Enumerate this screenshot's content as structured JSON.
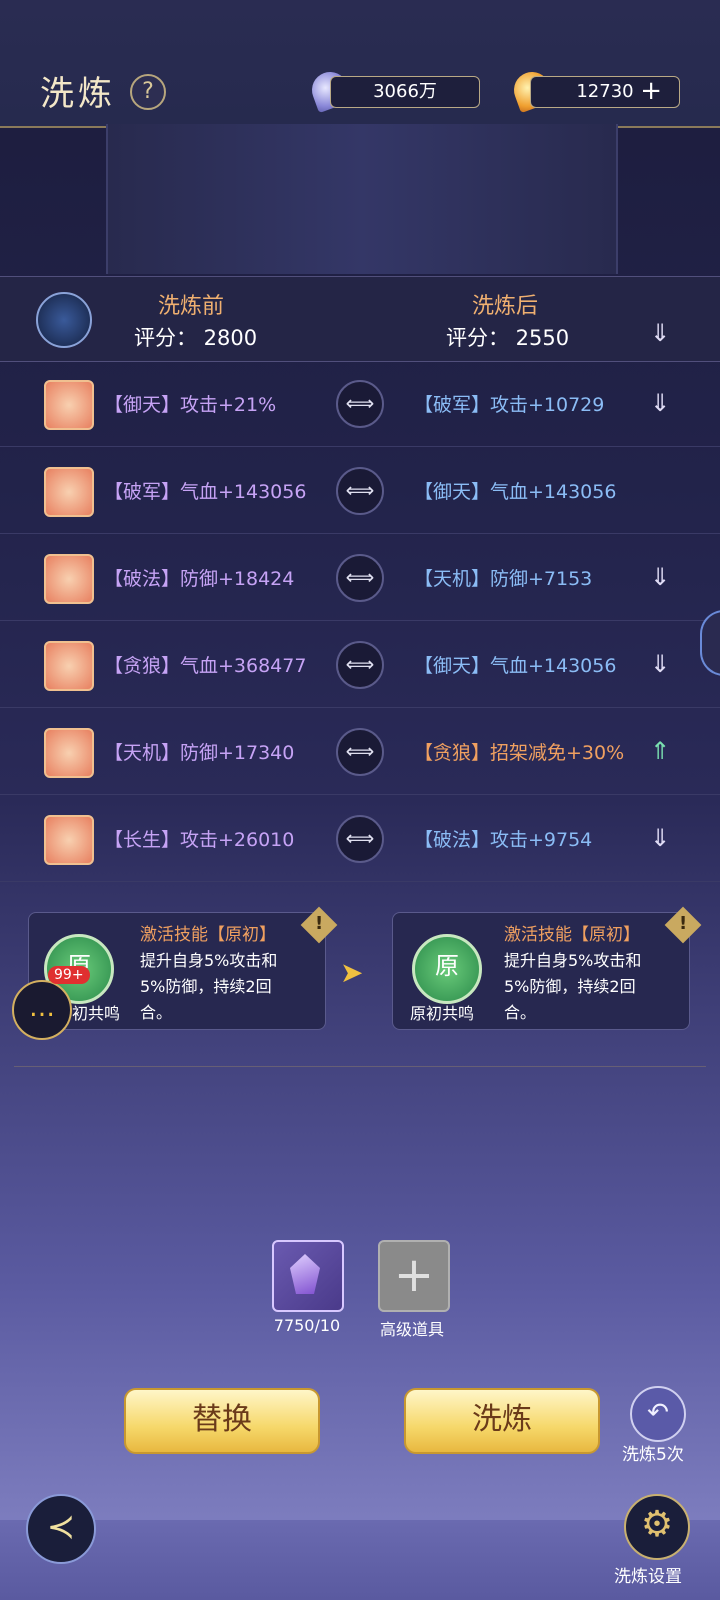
{
  "header": {
    "title": "洗炼",
    "help": "?",
    "currency1": "3066万",
    "currency2": "12730",
    "plus": "+"
  },
  "compare": {
    "before_label": "洗炼前",
    "after_label": "洗炼后",
    "before_score": "评分：  2800",
    "after_score": "评分：  2550"
  },
  "rows": [
    {
      "left": "【御天】攻击+21%",
      "right": "【破军】攻击+10729",
      "trend": "down"
    },
    {
      "left": "【破军】气血+143056",
      "right": "【御天】气血+143056",
      "trend": "none"
    },
    {
      "left": "【破法】防御+18424",
      "right": "【天机】防御+7153",
      "trend": "down"
    },
    {
      "left": "【贪狼】气血+368477",
      "right": "【御天】气血+143056",
      "trend": "down"
    },
    {
      "left": "【天机】防御+17340",
      "right": "【贪狼】招架减免+30%",
      "trend": "up"
    },
    {
      "left": "【长生】攻击+26010",
      "right": "【破法】攻击+9754",
      "trend": "down"
    }
  ],
  "skills": {
    "before": {
      "name": "激活技能【原初】",
      "desc1": "提升自身5%攻击和",
      "desc2": "5%防御，持续2回",
      "desc3": "合。",
      "icon": "原",
      "icon_sub": "初",
      "label": "初共鸣"
    },
    "after": {
      "name": "激活技能【原初】",
      "desc1": "提升自身5%攻击和",
      "desc2": "5%防御，持续2回",
      "desc3": "合。",
      "icon": "原",
      "icon_sub": "初",
      "label": "原初共鸣"
    }
  },
  "chat": {
    "badge": "99+"
  },
  "items": {
    "count": "7750/10",
    "advanced": "高级道具"
  },
  "buttons": {
    "replace": "替换",
    "refine": "洗炼",
    "refine5": "洗炼5次",
    "settings": "洗炼设置"
  },
  "icons": {
    "lock": "⟺",
    "down": "⇓",
    "up": "⇑",
    "back": "≺",
    "gear": "⚙",
    "undo": "↶",
    "warn": "!",
    "chat": "…"
  }
}
